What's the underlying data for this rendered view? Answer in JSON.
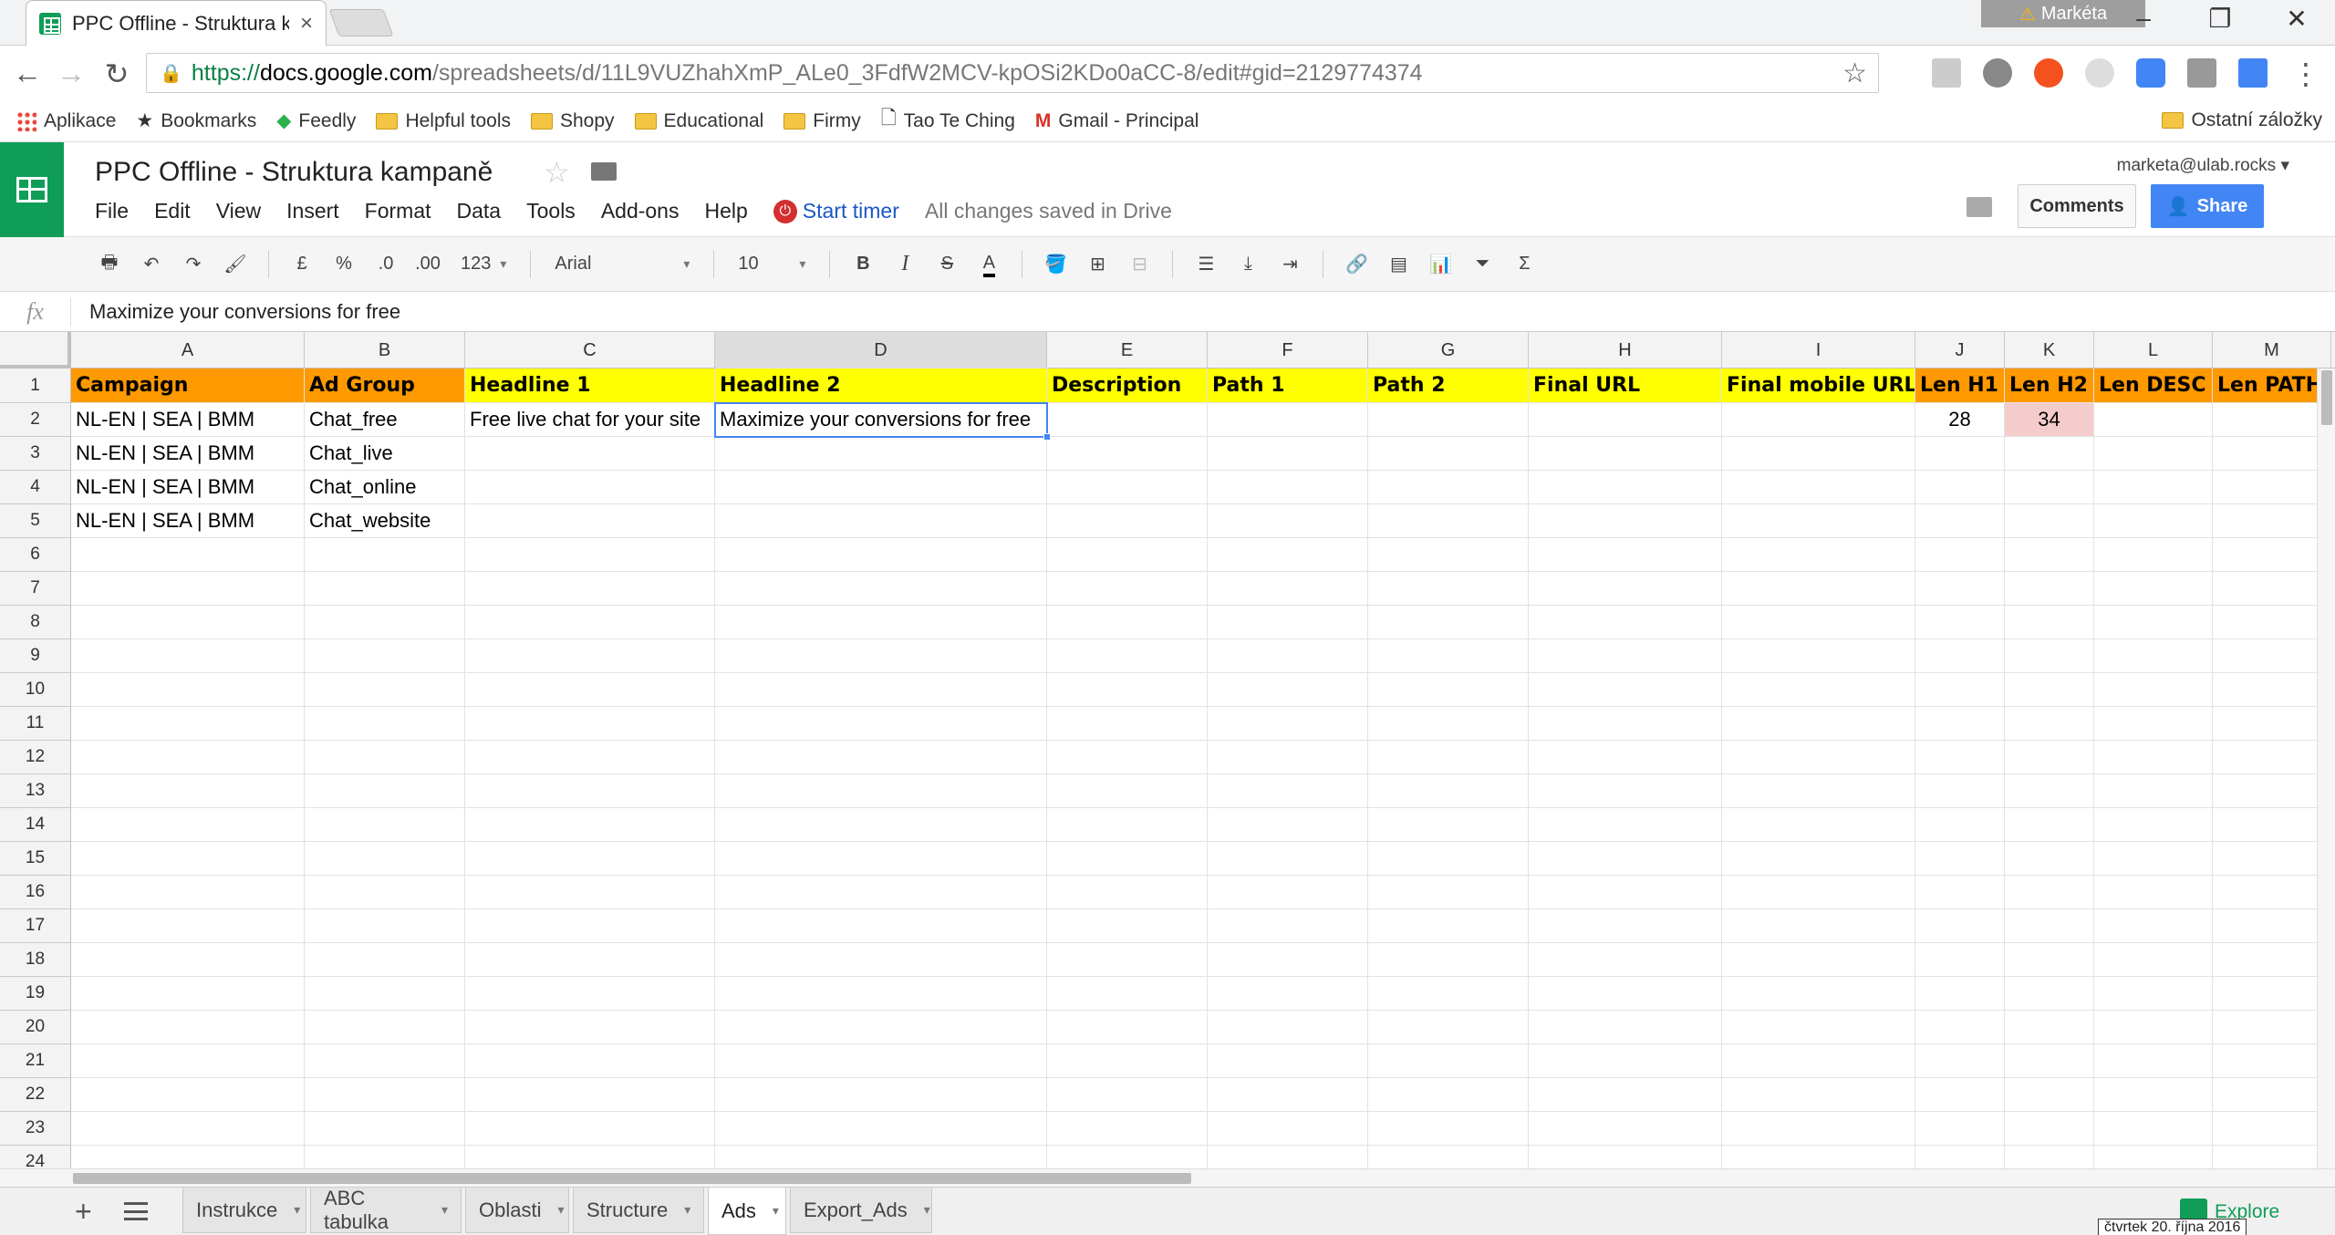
{
  "browser": {
    "tab_title": "PPC Offline - Struktura kampaně - Google Sheets",
    "profile_name": "Markéta",
    "url": {
      "scheme": "https://",
      "host": "docs.google.com",
      "path": "/spreadsheets/d/11L9VUZhahXmP_ALe0_3FdfW2MCV-kpOSi2KDo0aCC-8/edit#gid=2129774374"
    },
    "bookmarks": [
      {
        "label": "Aplikace",
        "icon": "apps-grid-icon"
      },
      {
        "label": "Bookmarks",
        "icon": "star-icon"
      },
      {
        "label": "Feedly",
        "icon": "feedly-icon"
      },
      {
        "label": "Helpful tools",
        "icon": "folder-icon"
      },
      {
        "label": "Shopy",
        "icon": "folder-icon"
      },
      {
        "label": "Educational",
        "icon": "folder-icon"
      },
      {
        "label": "Firmy",
        "icon": "folder-icon"
      },
      {
        "label": "Tao Te Ching",
        "icon": "page-icon"
      },
      {
        "label": "Gmail - Principal",
        "icon": "gmail-icon"
      }
    ],
    "other_bookmarks": "Ostatní záložky"
  },
  "doc": {
    "title": "PPC Offline - Struktura kampaně",
    "account": "marketa@ulab.rocks",
    "menu": [
      "File",
      "Edit",
      "View",
      "Insert",
      "Format",
      "Data",
      "Tools",
      "Add-ons",
      "Help"
    ],
    "timer_label": "Start timer",
    "saved_status": "All changes saved in Drive",
    "comments_label": "Comments",
    "share_label": "Share"
  },
  "toolbar": {
    "currency": "£",
    "percent": "%",
    "dec_less": ".0",
    "dec_more": ".00",
    "more_formats": "123",
    "font": "Arial",
    "font_size": "10"
  },
  "formula_bar": {
    "fx": "fx",
    "value": "Maximize your conversions for free"
  },
  "grid": {
    "columns": [
      "A",
      "B",
      "C",
      "D",
      "E",
      "F",
      "G",
      "H",
      "I",
      "J",
      "K",
      "L",
      "M"
    ],
    "row_numbers": [
      "1",
      "2",
      "3",
      "4",
      "5",
      "6",
      "7",
      "8",
      "9",
      "10",
      "11",
      "12",
      "13",
      "14",
      "15",
      "16",
      "17",
      "18",
      "19",
      "20",
      "21",
      "22",
      "23",
      "24"
    ],
    "header_row": [
      "Campaign",
      "Ad Group",
      "Headline 1",
      "Headline 2",
      "Description",
      "Path 1",
      "Path 2",
      "Final URL",
      "Final mobile URL",
      "Len H1",
      "Len H2",
      "Len DESC",
      "Len PATH"
    ],
    "rows": [
      [
        "NL-EN | SEA | BMM",
        "Chat_free",
        "Free live chat for your site",
        "Maximize your conversions for free",
        "",
        "",
        "",
        "",
        "",
        "28",
        "34",
        "",
        ""
      ],
      [
        "NL-EN | SEA | BMM",
        "Chat_live",
        "",
        "",
        "",
        "",
        "",
        "",
        "",
        "",
        "",
        "",
        ""
      ],
      [
        "NL-EN | SEA | BMM",
        "Chat_online",
        "",
        "",
        "",
        "",
        "",
        "",
        "",
        "",
        "",
        "",
        ""
      ],
      [
        "NL-EN | SEA | BMM",
        "Chat_website",
        "",
        "",
        "",
        "",
        "",
        "",
        "",
        "",
        "",
        "",
        ""
      ]
    ],
    "selected_cell": "D2"
  },
  "sheets": [
    {
      "label": "Instrukce",
      "active": false
    },
    {
      "label": "ABC tabulka",
      "active": false
    },
    {
      "label": "Oblasti",
      "active": false
    },
    {
      "label": "Structure",
      "active": false
    },
    {
      "label": "Ads",
      "active": true
    },
    {
      "label": "Export_Ads",
      "active": false
    }
  ],
  "explore_label": "Explore",
  "date_tooltip": "čtvrtek 20. října 2016",
  "colors": {
    "orange_header": "#ff9900",
    "yellow_header": "#ffff00",
    "pink_cell": "#f4cccc",
    "accent_blue": "#4285f4",
    "sheets_green": "#0f9d58"
  }
}
